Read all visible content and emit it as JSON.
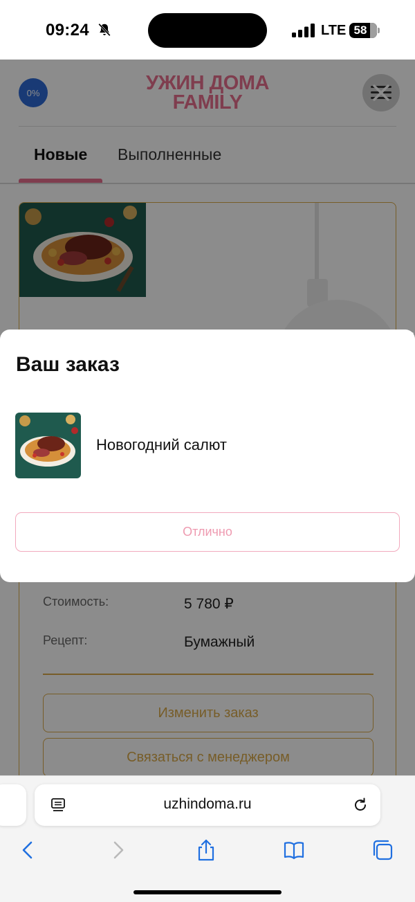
{
  "status_bar": {
    "time": "09:24",
    "network": "LTE",
    "battery": "58"
  },
  "header": {
    "discount_badge": "0%",
    "logo_line1": "УЖИН ДОМА",
    "logo_line2": "FAMILY"
  },
  "tabs": [
    {
      "label": "Новые",
      "active": true
    },
    {
      "label": "Выполненные",
      "active": false
    }
  ],
  "order_card": {
    "price_label": "Стоимость:",
    "price_value": "5 780 ₽",
    "recipe_label": "Рецепт:",
    "recipe_value": "Бумажный",
    "change_button": "Изменить заказ",
    "contact_button": "Связаться с менеджером"
  },
  "modal": {
    "title": "Ваш заказ",
    "item_name": "Новогодний салют",
    "ok_button": "Отлично"
  },
  "browser": {
    "url": "uzhindoma.ru"
  },
  "colors": {
    "brand_pink": "#e8708f",
    "accent_gold": "#d9a94a",
    "badge_blue": "#2f6bd6"
  }
}
